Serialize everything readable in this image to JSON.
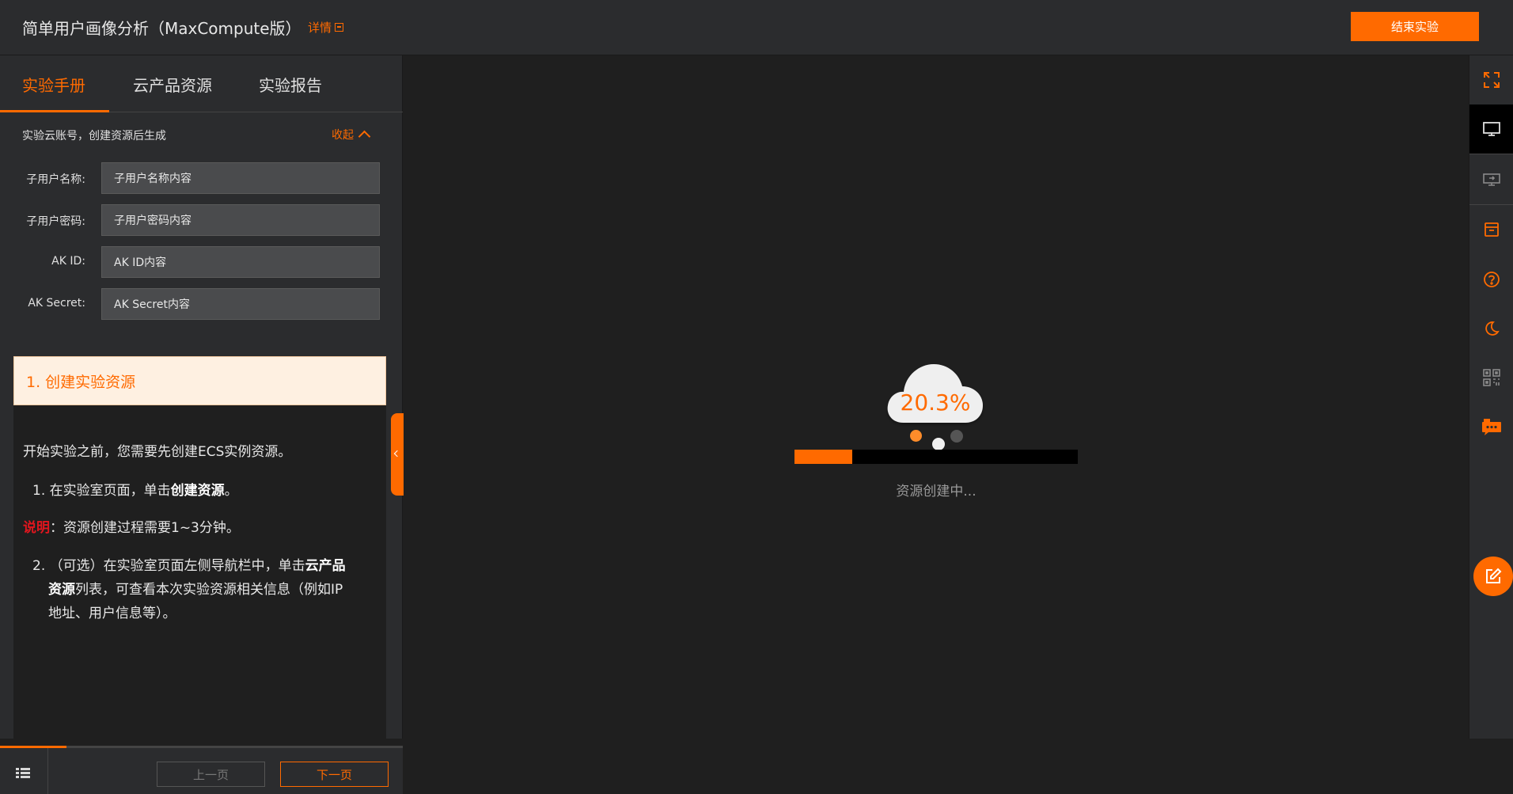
{
  "header": {
    "title": "简单用户画像分析（MaxCompute版）",
    "detail_label": "详情",
    "end_button": "结束实验"
  },
  "tabs": [
    {
      "label": "实验手册",
      "active": true
    },
    {
      "label": "云产品资源",
      "active": false
    },
    {
      "label": "实验报告",
      "active": false
    }
  ],
  "account": {
    "heading": "实验云账号，创建资源后生成",
    "collapse_label": "收起",
    "fields": [
      {
        "label": "子用户名称:",
        "value": "子用户名称内容"
      },
      {
        "label": "子用户密码:",
        "value": "子用户密码内容"
      },
      {
        "label": "AK ID:",
        "value": "AK ID内容"
      },
      {
        "label": "AK Secret:",
        "value": "AK Secret内容"
      }
    ]
  },
  "manual": {
    "step_title": "1. 创建实验资源",
    "intro": "开始实验之前，您需要先创建ECS实例资源。",
    "item1_prefix": "1. 在实验室页面，单击",
    "item1_bold": "创建资源",
    "item1_suffix": "。",
    "note_label": "说明",
    "note_text": "：资源创建过程需要1~3分钟。",
    "item2_prefix": "2. （可选）在实验室页面左侧导航栏中，单击",
    "item2_bold_a": "云产品",
    "item2_bold_b": "资源",
    "item2_mid": "列表，可查看本次实验资源相关信息（例如IP",
    "item2_end": "地址、用户信息等）。"
  },
  "pager": {
    "prev": "上一页",
    "next": "下一页",
    "reading_progress": 0.165
  },
  "loading": {
    "percent_text": "20.3%",
    "progress": 0.203,
    "status": "资源创建中..."
  },
  "colors": {
    "accent": "#ff6a00",
    "note_red": "#e0161e",
    "background": "#1f1f1f",
    "panel": "#2b2c2e"
  },
  "rightbar_icons": [
    "fullscreen-icon",
    "monitor-icon",
    "remote-desktop-icon",
    "archive-icon",
    "help-icon",
    "moon-icon",
    "qr-code-icon",
    "chat-icon",
    "edit-icon"
  ]
}
